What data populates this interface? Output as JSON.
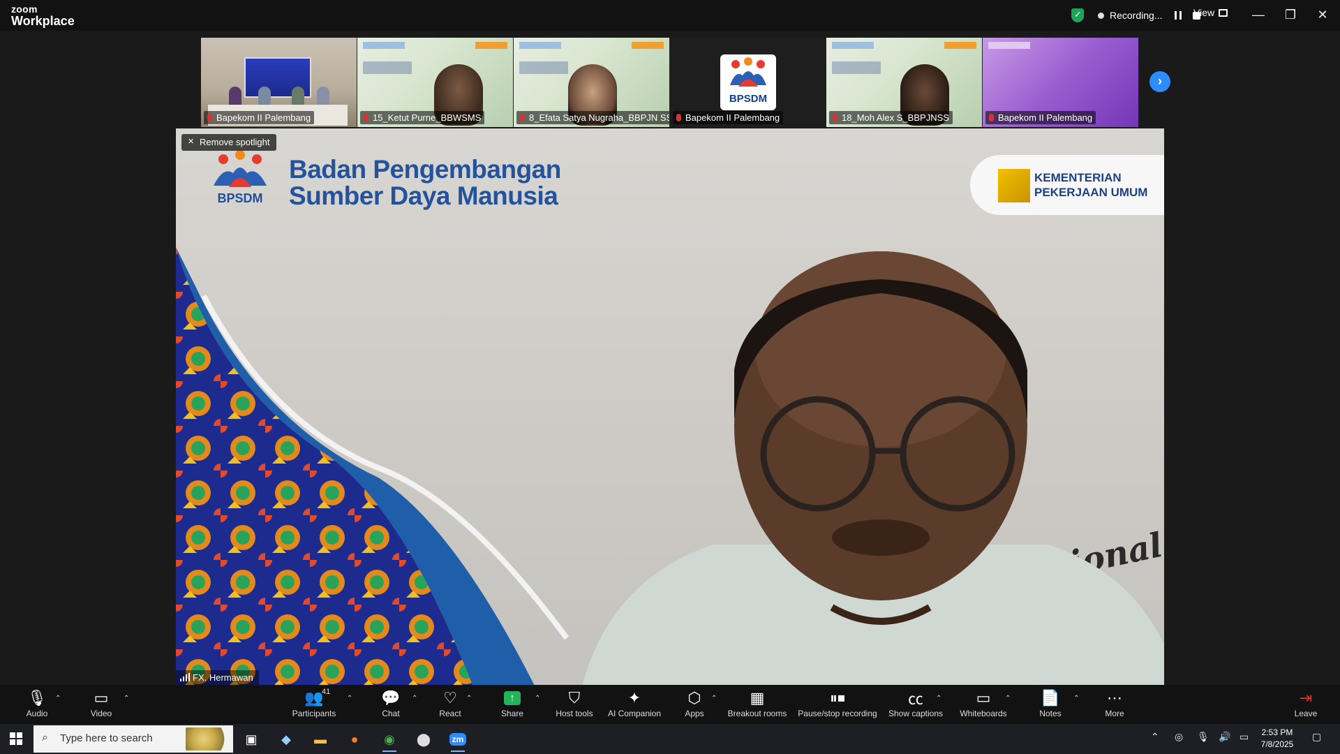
{
  "app": {
    "brand_line1": "zoom",
    "brand_line2": "Workplace",
    "recording_label": "Recording...",
    "view_label": "View",
    "window_controls": [
      "minimize-icon",
      "restore-icon",
      "close-icon"
    ]
  },
  "filmstrip": {
    "tiles": [
      {
        "name": "Bapekom II Palembang",
        "kind": "room"
      },
      {
        "name": "15_Ketut Purne_BBWSMS",
        "kind": "slide"
      },
      {
        "name": "8_Efata Satya Nugraha_BBPJN SS",
        "kind": "slide"
      },
      {
        "name": "Bapekom II Palembang",
        "kind": "logo",
        "logo_text": "BPSDM"
      },
      {
        "name": "18_Moh Alex S_BBPJNSS",
        "kind": "slide"
      },
      {
        "name": "Bapekom II Palembang",
        "kind": "purple"
      }
    ],
    "next_icon": "chevron-right-icon"
  },
  "main": {
    "remove_spotlight": "Remove spotlight",
    "banner_title_line1": "Badan Pengembangan",
    "banner_title_line2": "Sumber Daya Manusia",
    "logo_text": "BPSDM",
    "ministry_line1": "KEMENTERIAN",
    "ministry_line2": "PEKERJAAN UMUM",
    "script_text": "Profesional",
    "speaker_name": "FX. Hermawan"
  },
  "toolbar": {
    "audio": "Audio",
    "video": "Video",
    "participants": "Participants",
    "participants_count": "41",
    "chat": "Chat",
    "react": "React",
    "share": "Share",
    "host_tools": "Host tools",
    "ai_companion": "AI Companion",
    "apps": "Apps",
    "breakout_rooms": "Breakout rooms",
    "pause_stop_recording": "Pause/stop recording",
    "show_captions": "Show captions",
    "whiteboards": "Whiteboards",
    "notes": "Notes",
    "more": "More",
    "leave": "Leave",
    "colors": {
      "share_green": "#22b35b",
      "leave_red": "#e02f2f",
      "accent_blue": "#2d8cff"
    }
  },
  "taskbar": {
    "search_placeholder": "Type here to search",
    "time": "2:53 PM",
    "date": "7/8/2025"
  }
}
